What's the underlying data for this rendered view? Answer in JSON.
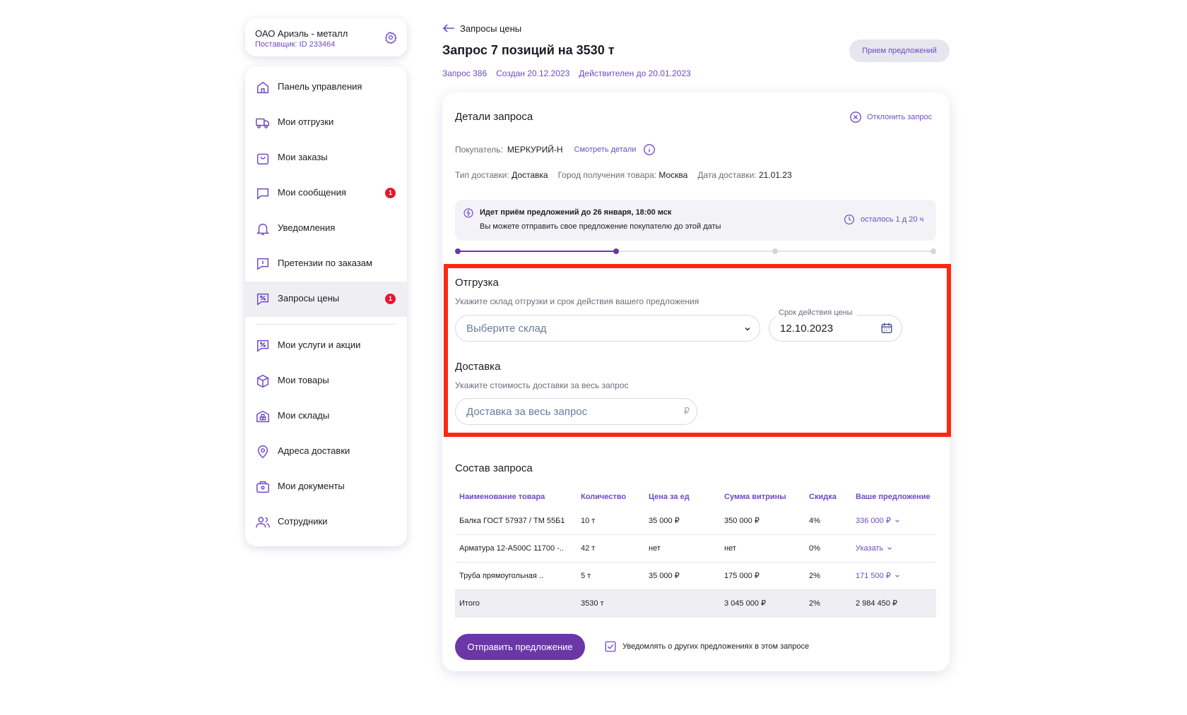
{
  "company": {
    "name": "ОАО Ариэль - металл",
    "supplier_id": "Поставщик: ID 233464",
    "settings_icon": "gear-icon"
  },
  "sidebar": {
    "items": [
      {
        "label": "Панель управления",
        "icon": "home-icon"
      },
      {
        "label": "Мои отгрузки",
        "icon": "truck-icon"
      },
      {
        "label": "Мои заказы",
        "icon": "bag-icon"
      },
      {
        "label": "Мои сообщения",
        "icon": "chat-icon",
        "badge": "1"
      },
      {
        "label": "Уведомления",
        "icon": "bell-icon"
      },
      {
        "label": "Претензии по заказам",
        "icon": "claim-icon"
      },
      {
        "label": "Запросы цены",
        "icon": "price-request-icon",
        "badge": "1",
        "active": true
      },
      {
        "label": "Мои услуги и акции",
        "icon": "percent-icon"
      },
      {
        "label": "Мои товары",
        "icon": "box-icon"
      },
      {
        "label": "Мои склады",
        "icon": "warehouse-icon"
      },
      {
        "label": "Адреса доставки",
        "icon": "pin-icon"
      },
      {
        "label": "Мои документы",
        "icon": "documents-icon"
      },
      {
        "label": "Сотрудники",
        "icon": "users-icon"
      }
    ]
  },
  "header": {
    "back_label": "Запросы цены",
    "title": "Запрос 7 позиций на 3530 т",
    "status": "Прием предложений",
    "request_no": "Запрос 386",
    "created": "Создан 20.12.2023",
    "valid_until": "Действителен до 20.01.2023"
  },
  "details": {
    "title": "Детали запроса",
    "decline_label": "Отклонить запрос",
    "buyer_label": "Покупатель:",
    "buyer_value": "МЕРКУРИЙ-Н",
    "buyer_details_link": "Смотреть детали",
    "delivery_type_label": "Тип доставки:",
    "delivery_type_value": "Доставка",
    "city_label": "Город получения товара:",
    "city_value": "Москва",
    "date_label": "Дата доставки:",
    "date_value": "21.01.23"
  },
  "notice": {
    "title": "Идет приём предложений до 26 января, 18:00 мск",
    "subtitle": "Вы можете отправить свое предложение покупателю до этой даты",
    "remaining": "осталось 1 д 20 ч"
  },
  "stepper": {
    "total_steps": 4,
    "current_step": 2,
    "accent": "#6b37a6"
  },
  "shipment": {
    "title": "Отгрузка",
    "hint": "Укажите склад отгрузки и срок действия вашего предложения",
    "warehouse_placeholder": "Выберите склад",
    "validity_label": "Срок действия цены",
    "validity_value": "12.10.2023"
  },
  "delivery": {
    "title": "Доставка",
    "hint": "Укажите стоимость доставки за весь запрос",
    "cost_placeholder": "Доставка за весь запрос",
    "currency": "₽"
  },
  "composition": {
    "title": "Состав запроса",
    "columns": [
      "Наименование товара",
      "Количество",
      "Цена за ед",
      "Сумма витрины",
      "Скидка",
      "Ваше предложение"
    ],
    "rows": [
      [
        "Балка ГОСТ 57937 / ТМ 55Б1",
        "10 т",
        "35 000 ₽",
        "350 000 ₽",
        "4%",
        "336 000 ₽"
      ],
      [
        "Арматура 12-А500С 11700 -..",
        "42 т",
        "нет",
        "нет",
        "0%",
        "Указать"
      ],
      [
        "Труба прямоугольная ..",
        "5 т",
        "35 000 ₽",
        "175 000 ₽",
        "2%",
        "171 500 ₽"
      ]
    ],
    "total": [
      "Итого",
      "3530 т",
      "",
      "3 045 000 ₽",
      "2%",
      "2 984 450 ₽"
    ]
  },
  "footer": {
    "submit_label": "Отправить предложение",
    "notify_label": "Уведомлять о других предложениях в этом запросе",
    "notify_checked": true
  },
  "colors": {
    "accent": "#6b37a6",
    "link": "#6e4bc4",
    "badge": "#e8152c",
    "highlight": "#fc2811"
  }
}
